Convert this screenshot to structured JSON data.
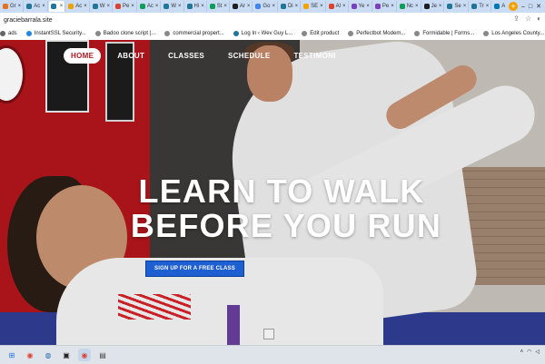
{
  "browser": {
    "tabs": [
      {
        "label": "Gr",
        "color": "#e8711c"
      },
      {
        "label": "Ac",
        "color": "#21759b"
      },
      {
        "label": "",
        "color": "#21759b",
        "active": true
      },
      {
        "label": "Ac",
        "color": "#f1a200"
      },
      {
        "label": "W",
        "color": "#21759b"
      },
      {
        "label": "Pe",
        "color": "#d9432f"
      },
      {
        "label": "Ac",
        "color": "#0f9d58"
      },
      {
        "label": "W",
        "color": "#21759b"
      },
      {
        "label": "Hi",
        "color": "#21759b"
      },
      {
        "label": "St",
        "color": "#0f9d58"
      },
      {
        "label": "Ar",
        "color": "#1e1e1e"
      },
      {
        "label": "Go",
        "color": "#4285f4"
      },
      {
        "label": "Di",
        "color": "#21759b"
      },
      {
        "label": "SE",
        "color": "#f1a200"
      },
      {
        "label": "Al",
        "color": "#d9432f"
      },
      {
        "label": "Ye",
        "color": "#7b3fc4"
      },
      {
        "label": "Pe",
        "color": "#7b3fc4"
      },
      {
        "label": "Nc",
        "color": "#0f9d58"
      },
      {
        "label": "Je",
        "color": "#1e1e1e"
      },
      {
        "label": "Se",
        "color": "#21759b"
      },
      {
        "label": "Tr",
        "color": "#21759b"
      },
      {
        "label": "Ar",
        "color": "#0077b5"
      },
      {
        "label": "Tr",
        "color": "#d9432f"
      },
      {
        "label": "Cl",
        "color": "#21759b"
      }
    ],
    "url": "graciebarrala.site",
    "bookmarks": [
      {
        "label": "ads",
        "color": "#666666"
      },
      {
        "label": "InstantSSL Security...",
        "color": "#1e88e5"
      },
      {
        "label": "Badoo clone script |...",
        "color": "#888888"
      },
      {
        "label": "commercial propert...",
        "color": "#888888"
      },
      {
        "label": "Log In ‹ Wev Guy L...",
        "color": "#21759b"
      },
      {
        "label": "Edit product",
        "color": "#888888"
      },
      {
        "label": "Perfectbot Modem...",
        "color": "#888888"
      },
      {
        "label": "Formidable | Forms...",
        "color": "#888888"
      },
      {
        "label": "Los Angeles County...",
        "color": "#888888"
      }
    ]
  },
  "nav": {
    "items": [
      {
        "label": "HOME",
        "active": true
      },
      {
        "label": "ABOUT",
        "active": false
      },
      {
        "label": "CLASSES",
        "active": false
      },
      {
        "label": "SCHEDULE",
        "active": false
      },
      {
        "label": "TESTIMONI",
        "active": false
      }
    ]
  },
  "hero": {
    "headline_line1": "LEARN TO WALK",
    "headline_line2": "BEFORE YOU RUN",
    "cta_label": "SIGN UP FOR A FREE CLASS"
  },
  "colors": {
    "brand_red": "#b2161c",
    "cta_blue": "#1e5fd2"
  },
  "taskbar": {
    "apps": [
      "windows-logo",
      "chrome-icon",
      "file-explorer-icon",
      "terminal-icon",
      "chrome-icon",
      "settings-icon"
    ]
  }
}
